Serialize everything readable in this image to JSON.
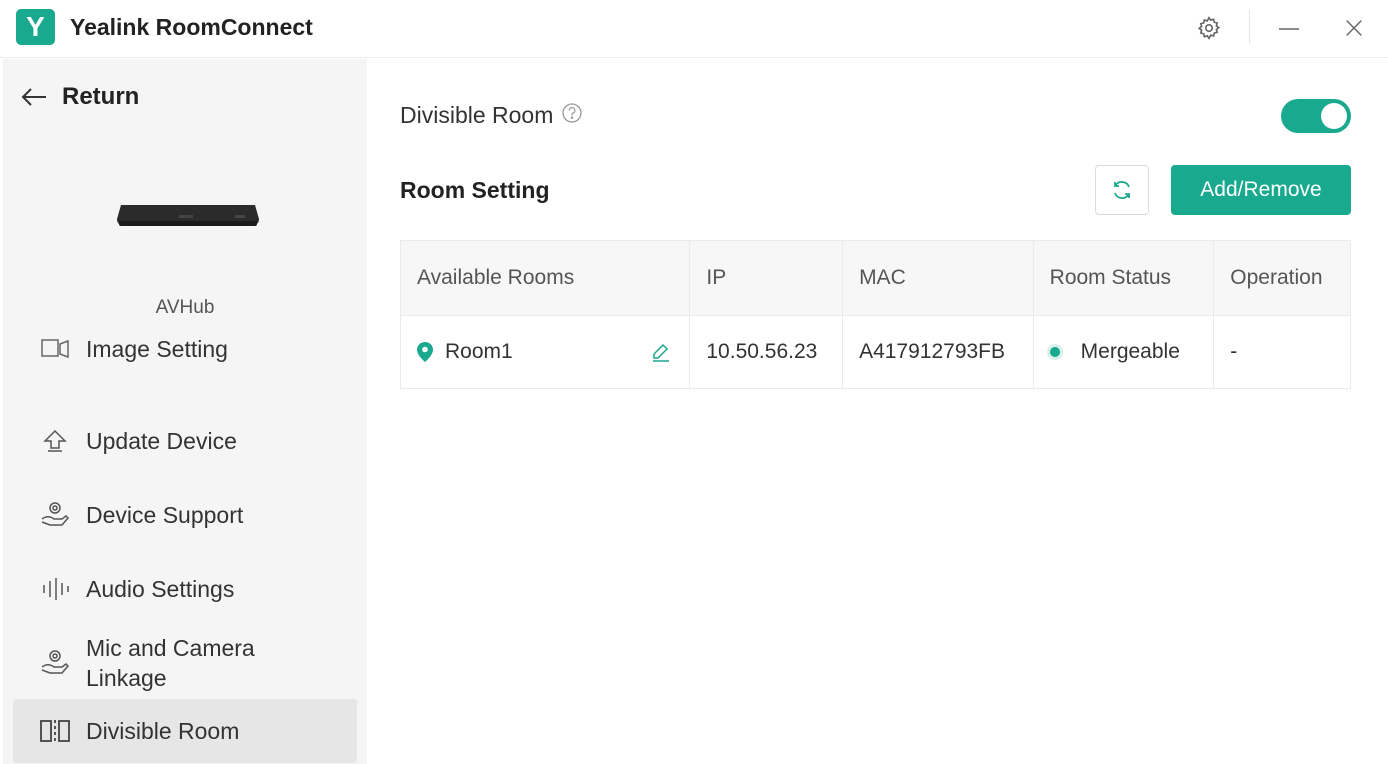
{
  "app": {
    "logo_letter": "Y",
    "title": "Yealink RoomConnect"
  },
  "window_controls": {
    "settings_icon": "gear-icon",
    "minimize_icon": "minimize-icon",
    "close_icon": "close-icon"
  },
  "sidebar": {
    "return_label": "Return",
    "device_name": "AVHub",
    "items": [
      {
        "label": "Image Setting",
        "icon": "image-setting-icon"
      },
      {
        "label": "Update Device",
        "icon": "update-icon"
      },
      {
        "label": "Device Support",
        "icon": "support-icon"
      },
      {
        "label": "Audio Settings",
        "icon": "audio-icon"
      },
      {
        "label": "Mic and Camera Linkage",
        "icon": "mic-camera-icon"
      },
      {
        "label": "Divisible Room",
        "icon": "divisible-room-icon",
        "active": true
      }
    ]
  },
  "main": {
    "divisible_label": "Divisible Room",
    "divisible_enabled": true,
    "room_setting_title": "Room Setting",
    "add_remove_label": "Add/Remove",
    "table": {
      "headers": [
        "Available Rooms",
        "IP",
        "MAC",
        "Room Status",
        "Operation"
      ],
      "rows": [
        {
          "room": "Room1",
          "ip": "10.50.56.23",
          "mac": "A417912793FB",
          "status": "Mergeable",
          "operation": "-"
        }
      ]
    }
  },
  "colors": {
    "accent": "#19a98e",
    "sidebar_bg": "#f5f5f5",
    "active_item_bg": "#e6e6e6"
  }
}
